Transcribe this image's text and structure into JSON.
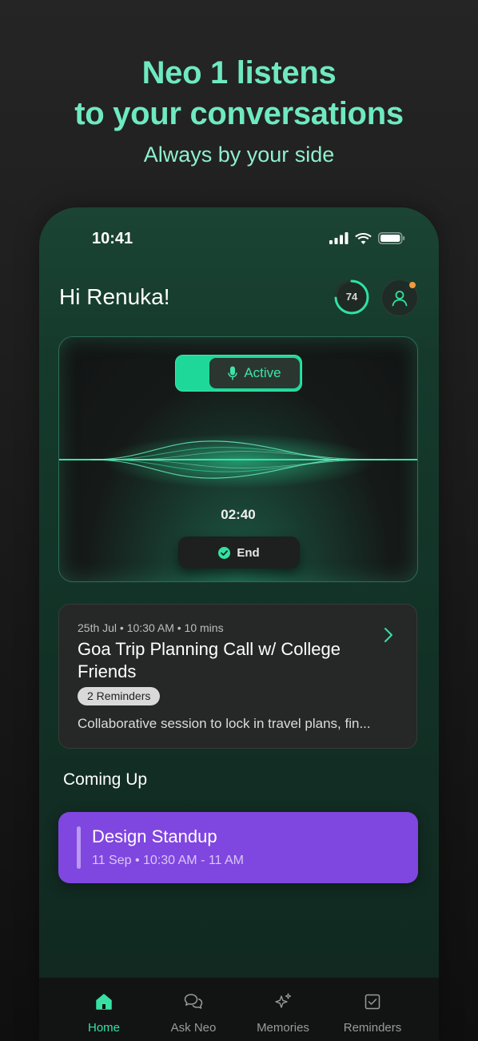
{
  "hero": {
    "title_line1": "Neo 1 listens",
    "title_line2": "to your conversations",
    "subtitle": "Always by your side"
  },
  "status_bar": {
    "time": "10:41",
    "icons": [
      "signal-icon",
      "wifi-icon",
      "battery-icon"
    ]
  },
  "header": {
    "greeting": "Hi Renuka!",
    "score": "74",
    "score_progress": 0.74,
    "notification_dot_color": "#f19a3e"
  },
  "listening": {
    "toggle_label": "Active",
    "toggle_icon": "microphone-icon",
    "timer": "02:40",
    "end_label": "End",
    "end_icon": "check-circle-icon"
  },
  "memory": {
    "meta": "25th Jul • 10:30 AM • 10 mins",
    "title": "Goa Trip Planning Call w/ College Friends",
    "badge": "2 Reminders",
    "description": "Collaborative session to lock in travel plans, fin..."
  },
  "coming_up": {
    "title": "Coming Up",
    "event_title": "Design Standup",
    "event_time": "11 Sep • 10:30 AM - 11 AM",
    "event_color": "#8046e0"
  },
  "nav": {
    "items": [
      {
        "label": "Home",
        "icon": "home-icon",
        "active": true
      },
      {
        "label": "Ask Neo",
        "icon": "chat-icon",
        "active": false
      },
      {
        "label": "Memories",
        "icon": "sparkle-icon",
        "active": false
      },
      {
        "label": "Reminders",
        "icon": "checkbox-icon",
        "active": false
      }
    ]
  },
  "colors": {
    "accent": "#38e0a4",
    "hero": "#6fe9c0",
    "background": "#1b1b1b"
  }
}
